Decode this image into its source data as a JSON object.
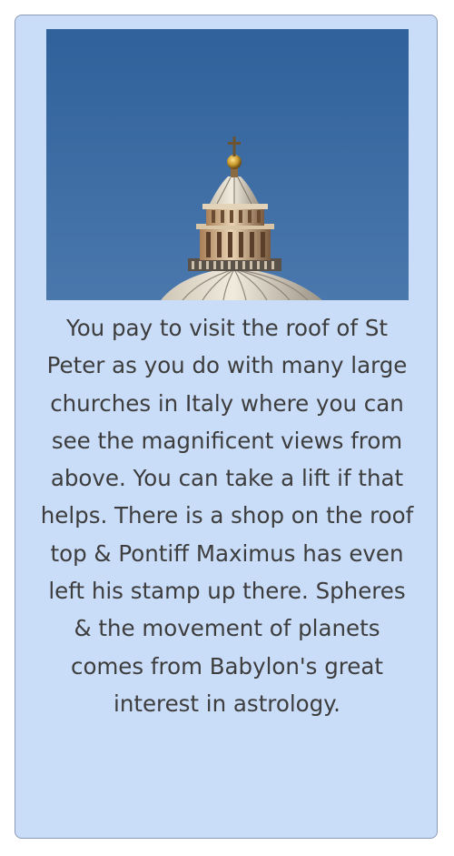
{
  "card": {
    "photo_subject": "dome-of-st-peters-basilica",
    "caption": "You pay to visit the roof of St Peter as you do with many large churches in Italy where you can see the magnificent views from above. You can take a lift if that helps. There is a shop on the roof top & Pontiff Maximus has even left his stamp up there. Spheres & the movement of planets comes from Babylon's great interest in astrology."
  },
  "colors": {
    "card_background": "#c9dcf8",
    "card_border": "#8a9ab3",
    "sky": "#3d6aa0",
    "text": "#3d3d3d"
  }
}
